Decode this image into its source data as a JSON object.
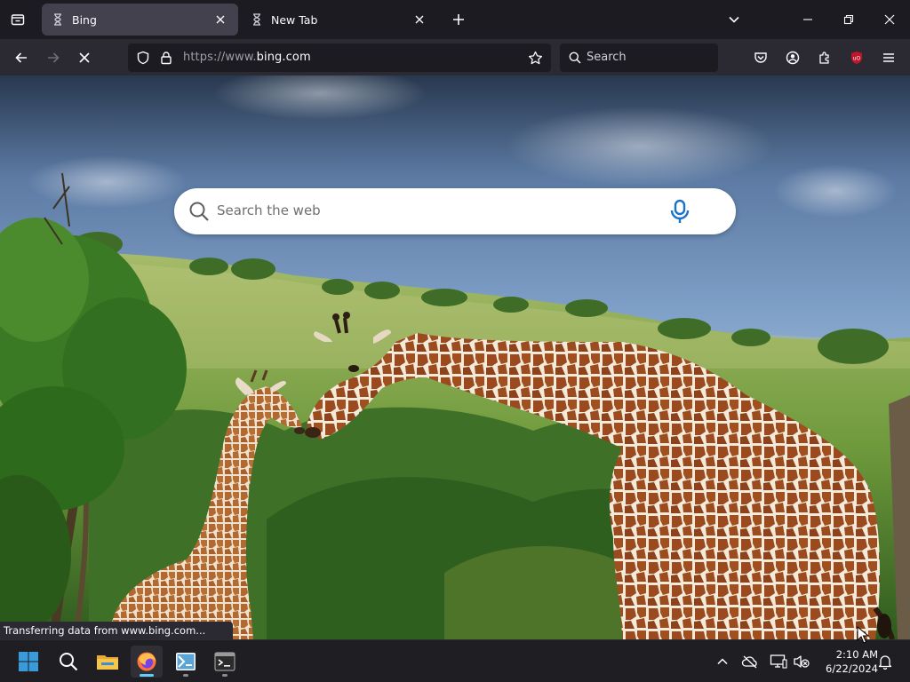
{
  "browser": {
    "tabs": [
      {
        "title": "Bing",
        "favicon": "hourglass-icon",
        "active": true
      },
      {
        "title": "New Tab",
        "favicon": "hourglass-icon",
        "active": false
      }
    ],
    "url": {
      "scheme": "https://",
      "host_prefix": "www.",
      "host": "bing.com"
    },
    "search_placeholder": "Search",
    "status_text": "Transferring data from www.bing.com...",
    "colors": {
      "tab_bar": "#1c1b22",
      "toolbar": "#2b2a33",
      "active_tab": "#42414d",
      "ublock": "#c0152a"
    }
  },
  "page": {
    "search_placeholder": "Search the web",
    "mic_color": "#1a73c8"
  },
  "taskbar": {
    "apps": [
      "windows-start-icon",
      "search-icon",
      "file-explorer-icon",
      "firefox-icon",
      "wsl-icon",
      "terminal-icon"
    ],
    "clock_time": "2:10 AM",
    "clock_date": "6/22/2024"
  }
}
